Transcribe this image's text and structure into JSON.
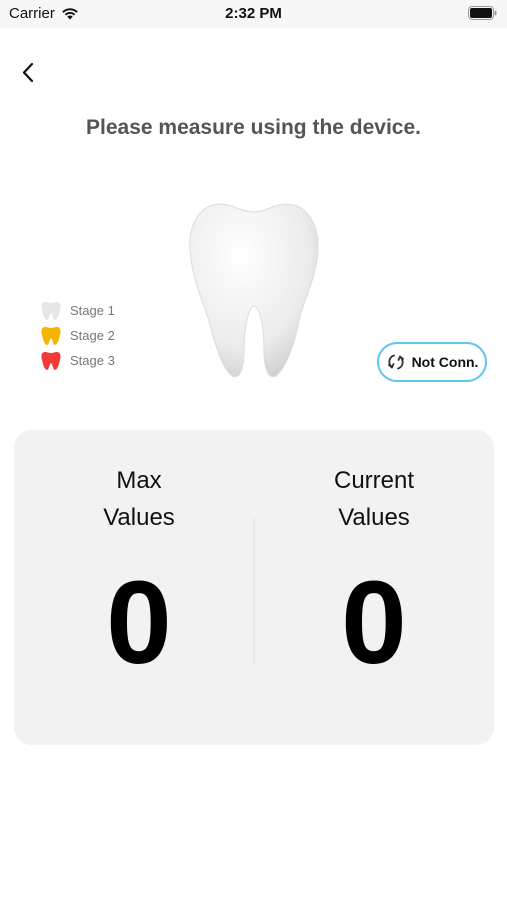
{
  "status_bar": {
    "carrier": "Carrier",
    "time": "2:32 PM",
    "wifi_icon": "wifi-icon",
    "battery_icon": "battery-full-icon"
  },
  "header": {
    "back_icon": "chevron-left-icon",
    "instruction": "Please measure using the device."
  },
  "legend": {
    "items": [
      {
        "label": "Stage 1",
        "color": "#e6e6e6"
      },
      {
        "label": "Stage 2",
        "color": "#f5b400"
      },
      {
        "label": "Stage 3",
        "color": "#f03a3a"
      }
    ]
  },
  "connection": {
    "label": "Not Conn.",
    "icon": "refresh-icon",
    "border_color": "#5bc7ea"
  },
  "values": {
    "max": {
      "title_line1": "Max",
      "title_line2": "Values",
      "value": "0"
    },
    "current": {
      "title_line1": "Current",
      "title_line2": "Values",
      "value": "0"
    }
  }
}
